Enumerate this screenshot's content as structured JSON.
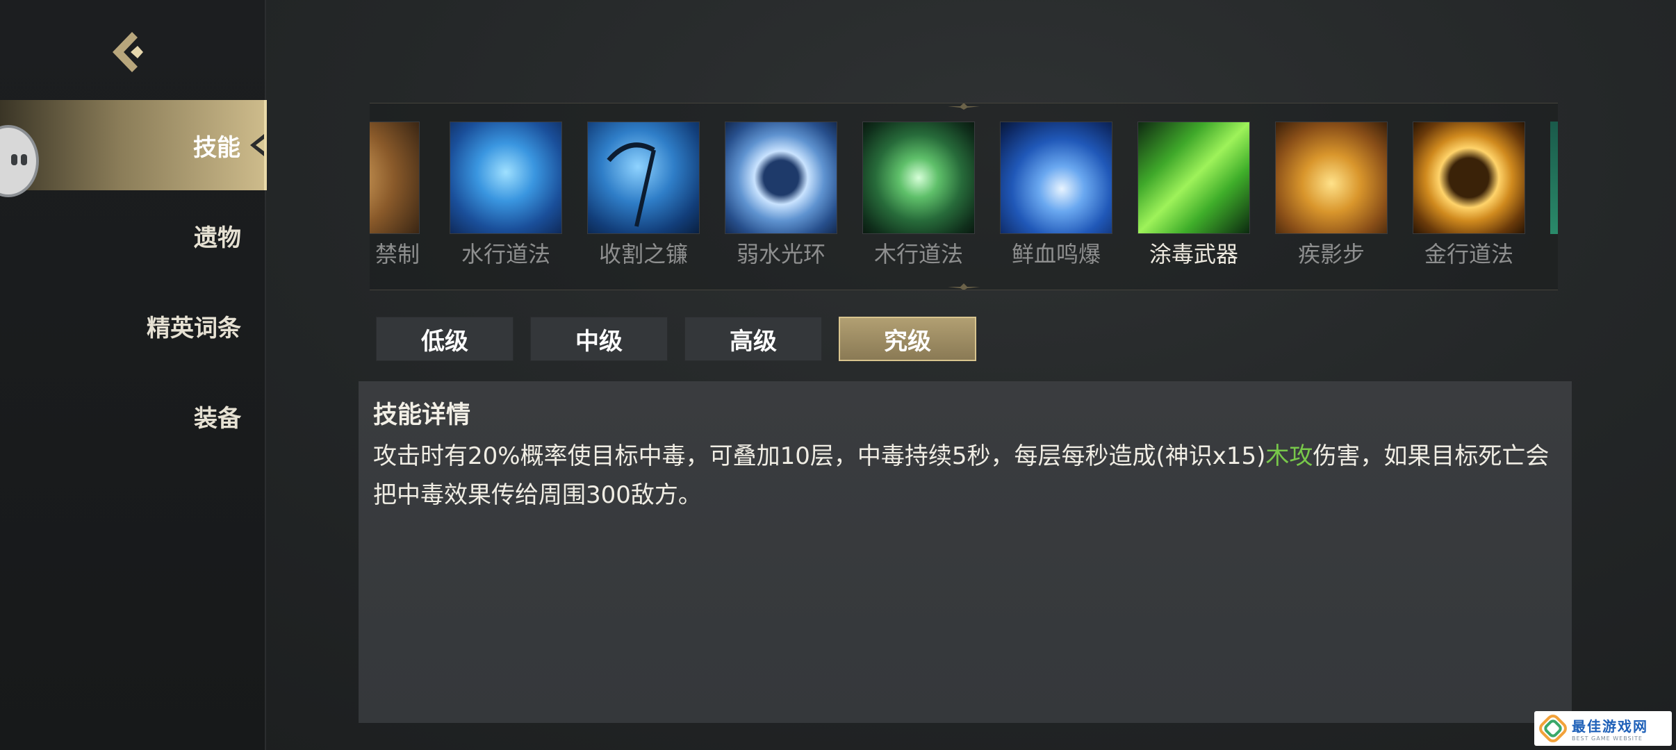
{
  "sidebar": {
    "items": [
      {
        "label": "技能",
        "active": true
      },
      {
        "label": "遗物",
        "active": false
      },
      {
        "label": "精英词条",
        "active": false
      },
      {
        "label": "装备",
        "active": false
      }
    ]
  },
  "skills": [
    {
      "name": "禁制",
      "icon": "seal-icon",
      "color": "#b07a3c"
    },
    {
      "name": "水行道法",
      "icon": "water-spell-icon",
      "color": "#2f7fd0"
    },
    {
      "name": "收割之镰",
      "icon": "scythe-icon",
      "color": "#2a6fae"
    },
    {
      "name": "弱水光环",
      "icon": "water-ring-icon",
      "color": "#5b84b8"
    },
    {
      "name": "木行道法",
      "icon": "wood-spell-icon",
      "color": "#3f9a52"
    },
    {
      "name": "鲜血鸣爆",
      "icon": "blood-burst-icon",
      "color": "#2a66c4"
    },
    {
      "name": "涂毒武器",
      "icon": "poison-weapon-icon",
      "color": "#6fd63a"
    },
    {
      "name": "疾影步",
      "icon": "boot-icon",
      "color": "#d1952c"
    },
    {
      "name": "金行道法",
      "icon": "metal-spell-icon",
      "color": "#d59a2a"
    }
  ],
  "selected_skill": "涂毒武器",
  "tiers": [
    "低级",
    "中级",
    "高级",
    "究级"
  ],
  "active_tier": "究级",
  "detail": {
    "title": "技能详情",
    "text_before": "攻击时有20%概率使目标中毒，可叠加10层，中毒持续5秒，每层每秒造成(神识x15)",
    "highlight": "木攻",
    "text_after": "伤害，如果目标死亡会把中毒效果传给周围300敌方。"
  },
  "watermark": {
    "main": "最佳游戏网",
    "sub": "BEST GAME WEBSITE"
  },
  "colors": {
    "accent_gold": "#b19f72",
    "highlight_green": "#78c84a"
  }
}
